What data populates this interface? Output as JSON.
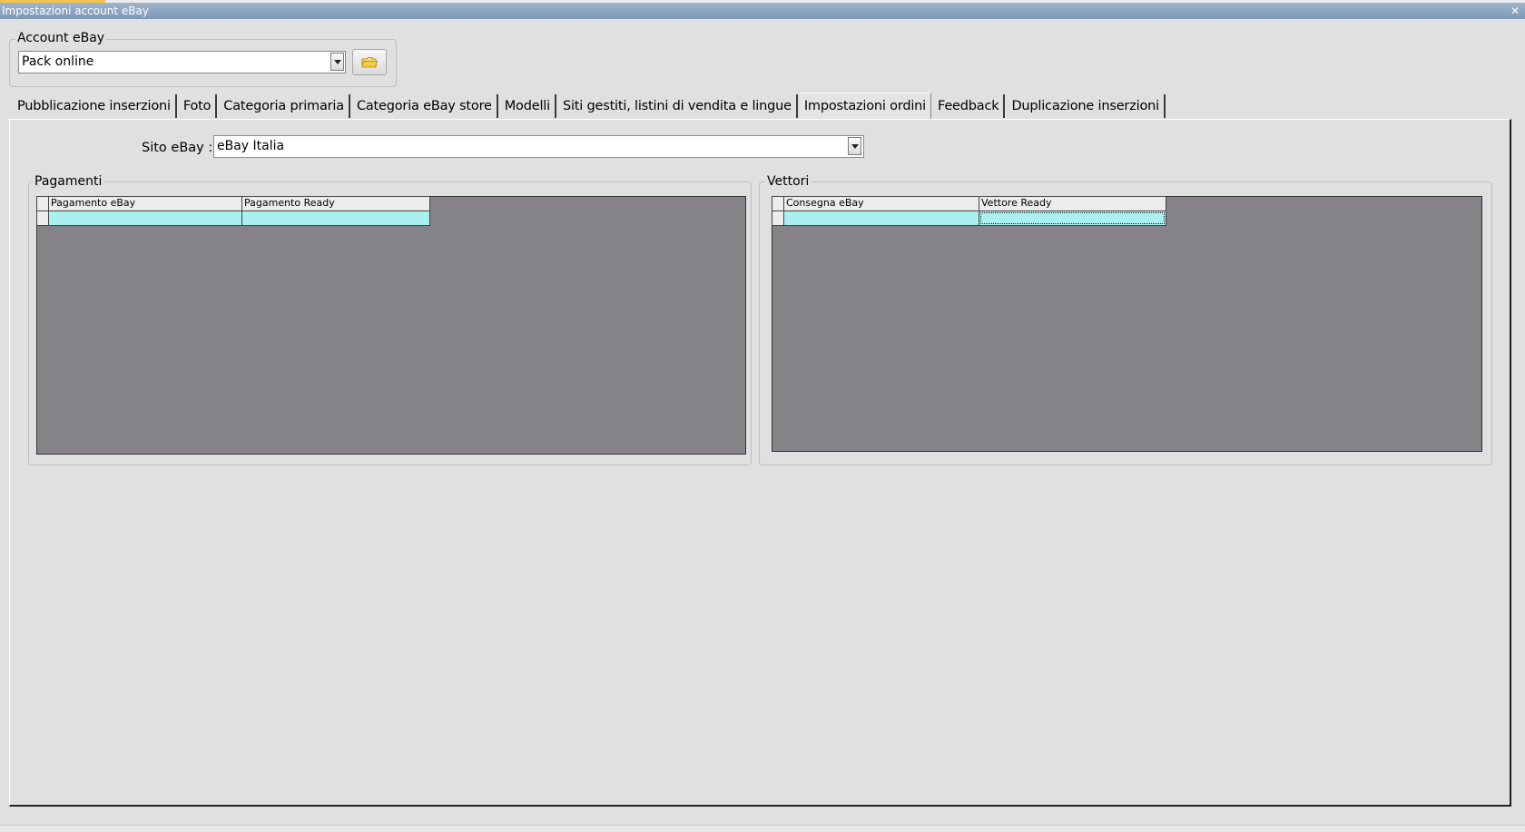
{
  "window": {
    "title": "Impostazioni account eBay"
  },
  "account": {
    "group_label": "Account eBay",
    "selected": "Pack online"
  },
  "tabs": [
    {
      "label": "Pubblicazione inserzioni"
    },
    {
      "label": "Foto"
    },
    {
      "label": "Categoria primaria"
    },
    {
      "label": "Categoria eBay store"
    },
    {
      "label": "Modelli"
    },
    {
      "label": "Siti gestiti, listini di vendita e lingue"
    },
    {
      "label": "Impostazioni ordini"
    },
    {
      "label": "Feedback"
    },
    {
      "label": "Duplicazione inserzioni"
    }
  ],
  "active_tab": "Impostazioni ordini",
  "site": {
    "label": "Sito eBay :",
    "selected": "eBay Italia"
  },
  "payments": {
    "group_label": "Pagamenti",
    "columns": [
      "Pagamento eBay",
      "Pagamento Ready"
    ],
    "rows": [
      [
        "",
        ""
      ]
    ]
  },
  "carriers": {
    "group_label": "Vettori",
    "columns": [
      "Consegna eBay",
      "Vettore Ready"
    ],
    "rows": [
      [
        "",
        ""
      ]
    ]
  },
  "colors": {
    "title_bar": "#8aa2bd",
    "grid_background": "#858387",
    "row_highlight": "#aaf0f0",
    "window_background": "#e0e0e0"
  }
}
